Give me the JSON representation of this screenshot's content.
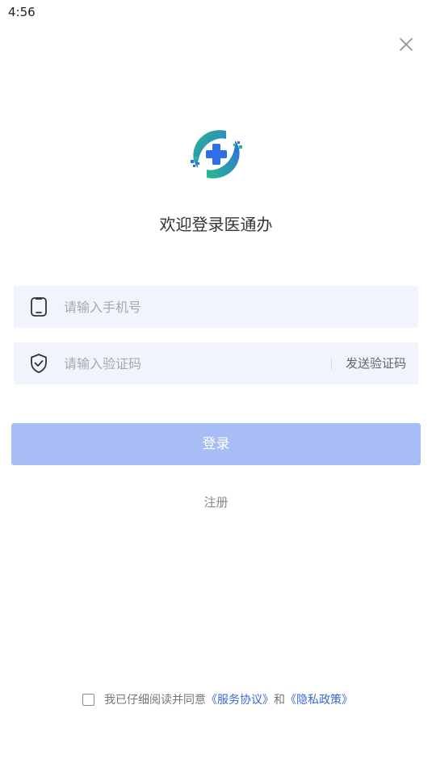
{
  "status_bar": {
    "time": "4:56"
  },
  "header": {
    "close_icon": "close-icon"
  },
  "logo": {
    "icon": "medical-cross-logo-icon",
    "colors": {
      "blue": "#2f6fe6",
      "green": "#2bb88a"
    }
  },
  "welcome": {
    "title": "欢迎登录医通办"
  },
  "phone_field": {
    "icon": "phone-icon",
    "placeholder": "请输入手机号",
    "value": ""
  },
  "code_field": {
    "icon": "shield-check-icon",
    "placeholder": "请输入验证码",
    "value": "",
    "send_label": "发送验证码"
  },
  "login": {
    "label": "登录",
    "color": "#a8bcf6"
  },
  "register": {
    "label": "注册"
  },
  "agreement": {
    "checked": false,
    "prefix": "我已仔细阅读并同意",
    "service_link": "《服务协议》",
    "connector": "和",
    "privacy_link": "《隐私政策》",
    "link_color": "#3a67d6"
  }
}
